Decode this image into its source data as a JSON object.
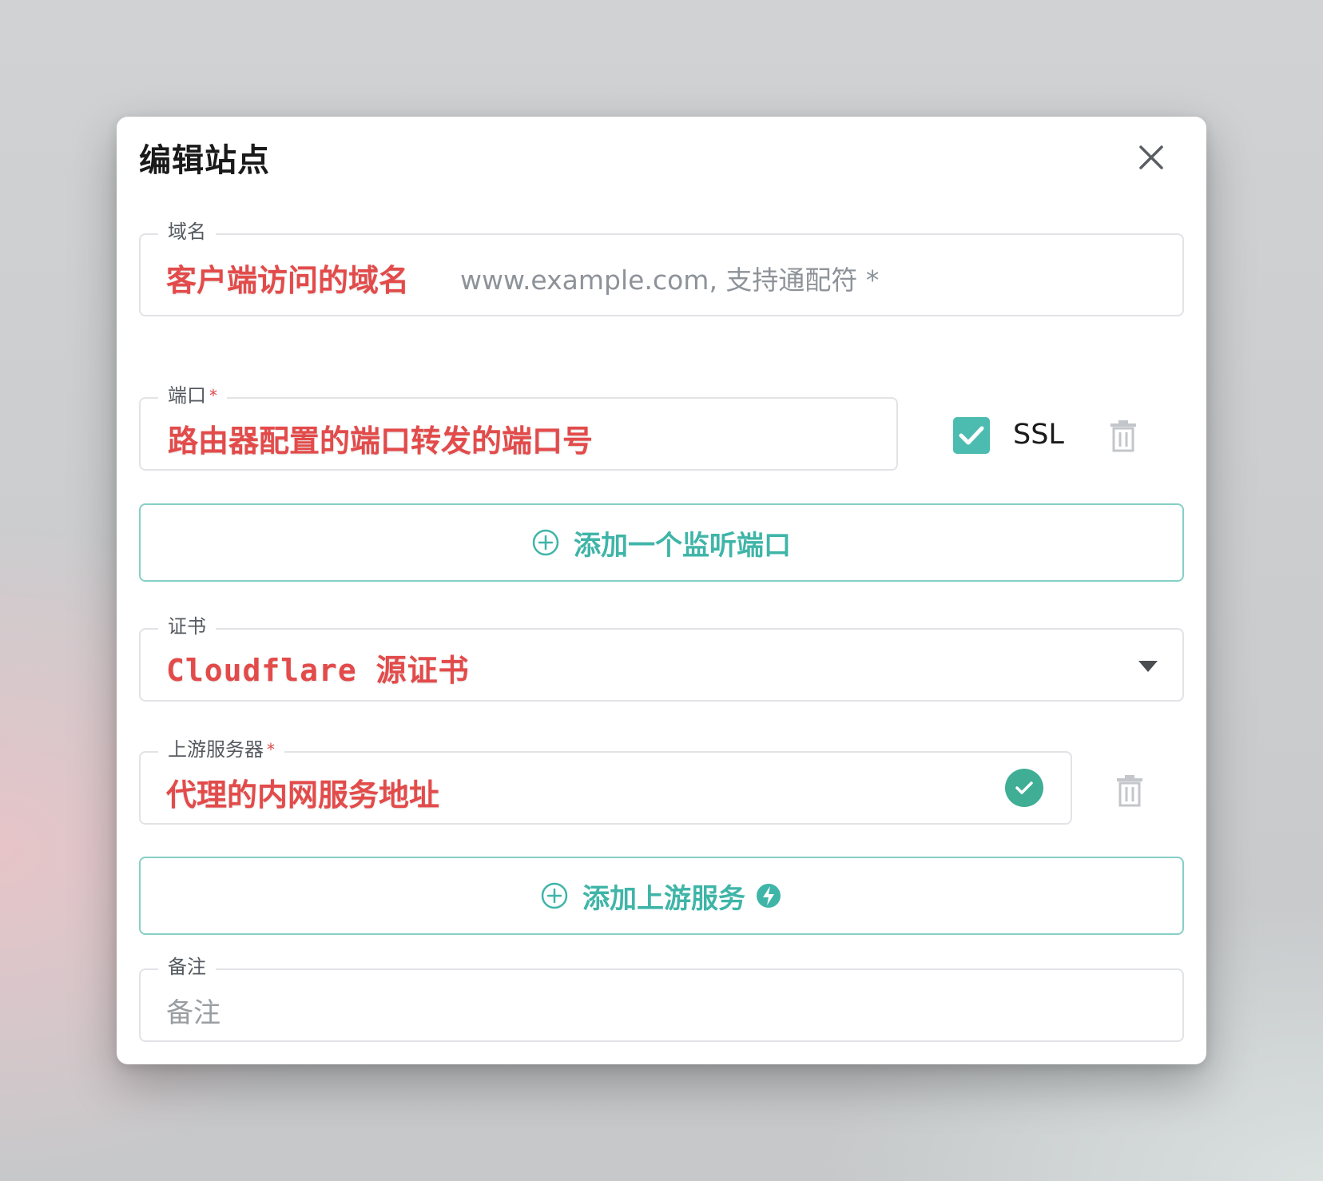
{
  "dialog": {
    "title": "编辑站点"
  },
  "domain": {
    "label": "域名",
    "annotation": "客户端访问的域名",
    "placeholder": "www.example.com, 支持通配符 *"
  },
  "port": {
    "label": "端口",
    "required_mark": "*",
    "annotation": "路由器配置的端口转发的端口号",
    "ssl_checked": true,
    "ssl_label": "SSL"
  },
  "add_port_button": {
    "label": "添加一个监听端口",
    "icon": "plus-circle-icon"
  },
  "certificate": {
    "label": "证书",
    "selected": "Cloudflare 源证书"
  },
  "upstream": {
    "label": "上游服务器",
    "required_mark": "*",
    "annotation": "代理的内网服务地址",
    "status": "valid"
  },
  "add_upstream_button": {
    "label": "添加上游服务",
    "icon": "plus-circle-icon",
    "badge_icon": "flash-icon"
  },
  "note": {
    "label": "备注",
    "placeholder": "备注"
  },
  "colors": {
    "accent": "#4cbcb0",
    "annotation_red": "#e34b4b",
    "border": "#e1e3e6"
  }
}
